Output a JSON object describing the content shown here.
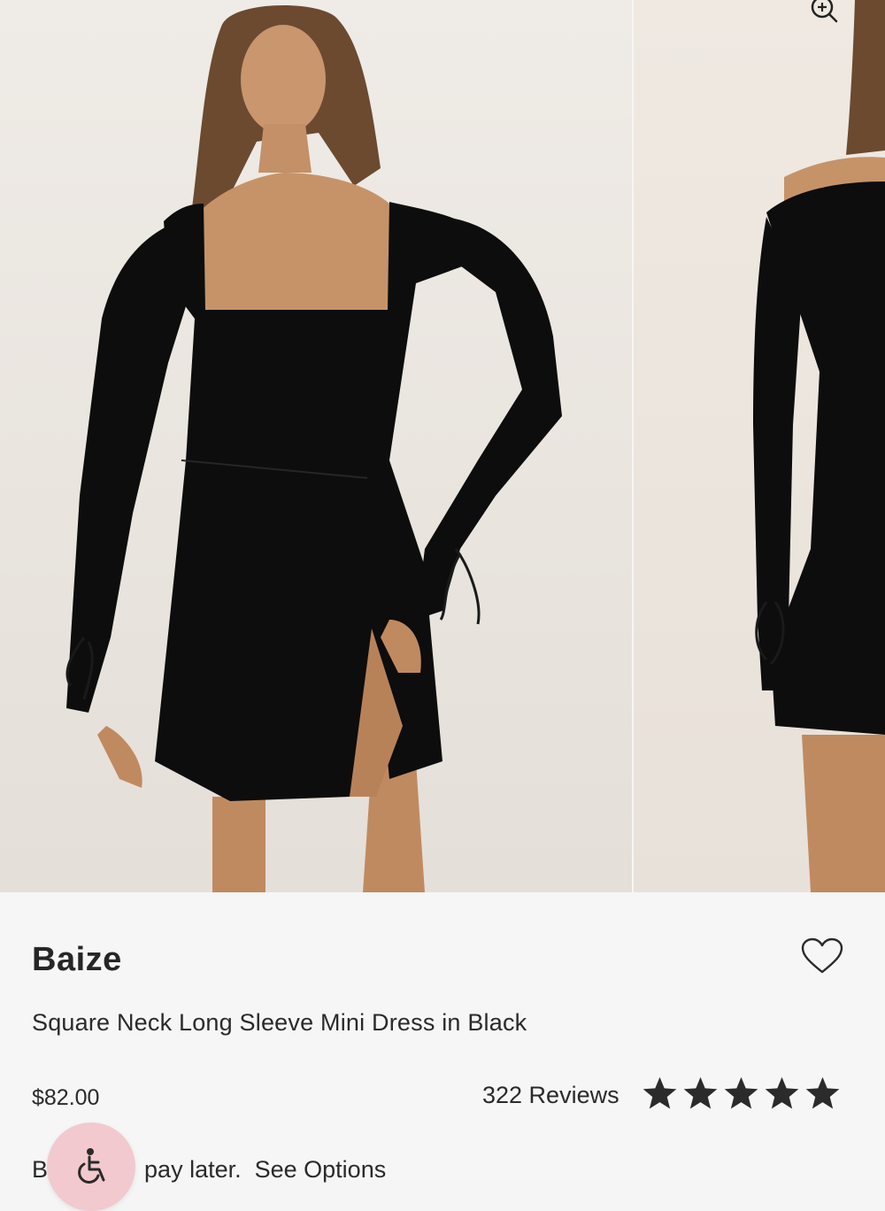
{
  "gallery": {
    "images": [
      {
        "alt": "model wearing black square neck long sleeve mini dress, front view"
      },
      {
        "alt": "model wearing black square neck long sleeve mini dress, back view"
      }
    ],
    "zoom_icon": "zoom-in-icon"
  },
  "product": {
    "brand": "Baize",
    "name": "Square Neck Long Sleeve Mini Dress in Black",
    "price": "$82.00",
    "reviews_label": "322 Reviews",
    "rating": 5,
    "rating_max": 5,
    "wishlist_icon": "heart-outline-icon",
    "bnpl_prefix": "Bu",
    "bnpl_middle": "pay later.",
    "bnpl_link": "See Options"
  },
  "accessibility": {
    "icon": "wheelchair-icon",
    "color": "#f2c9cf"
  },
  "colors": {
    "dress": "#0d0d0d",
    "skin": "#c9966e",
    "hair": "#6b4a30",
    "stars": "#2b2b2b"
  }
}
